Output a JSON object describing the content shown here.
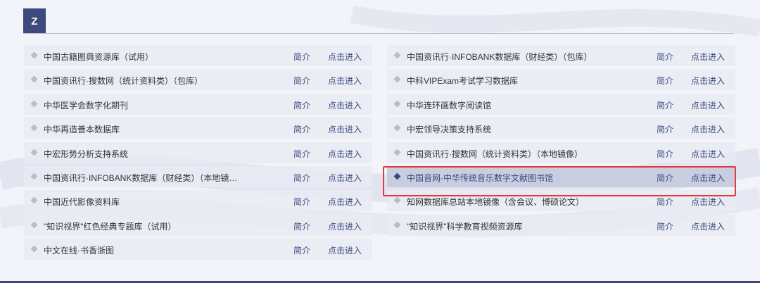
{
  "section": {
    "letter": "Z"
  },
  "labels": {
    "intro": "简介",
    "enter": "点击进入"
  },
  "left_items": [
    "中国古籍图典资源库（试用）",
    "中国资讯行·搜数网（统计资料类）（包库）",
    "中华医学会数字化期刊",
    "中华再造善本数据库",
    "中宏形势分析支持系统",
    "中国资讯行·INFOBANK数据库（财经类）（本地镜…",
    "中国近代影像资料库",
    "\"知识视界\"红色经典专题库（试用）",
    "中文在线·书香浙图"
  ],
  "right_items": [
    "中国资讯行·INFOBANK数据库（财经类）（包库）",
    "中科VIPExam考试学习数据库",
    "中华连环画数字阅读馆",
    "中宏领导决策支持系统",
    "中国资讯行·搜数网（统计资料类）（本地镜像）",
    "中国音网-中华传统音乐数字文献图书馆",
    "知网数据库总站本地镜像（含会议、博硕论文）",
    "\"知识视界\"科学教育视频资源库"
  ],
  "active_item": "中国音网-中华传统音乐数字文献图书馆",
  "colors": {
    "accent": "#3c4a7e",
    "highlight": "#e0393a"
  }
}
